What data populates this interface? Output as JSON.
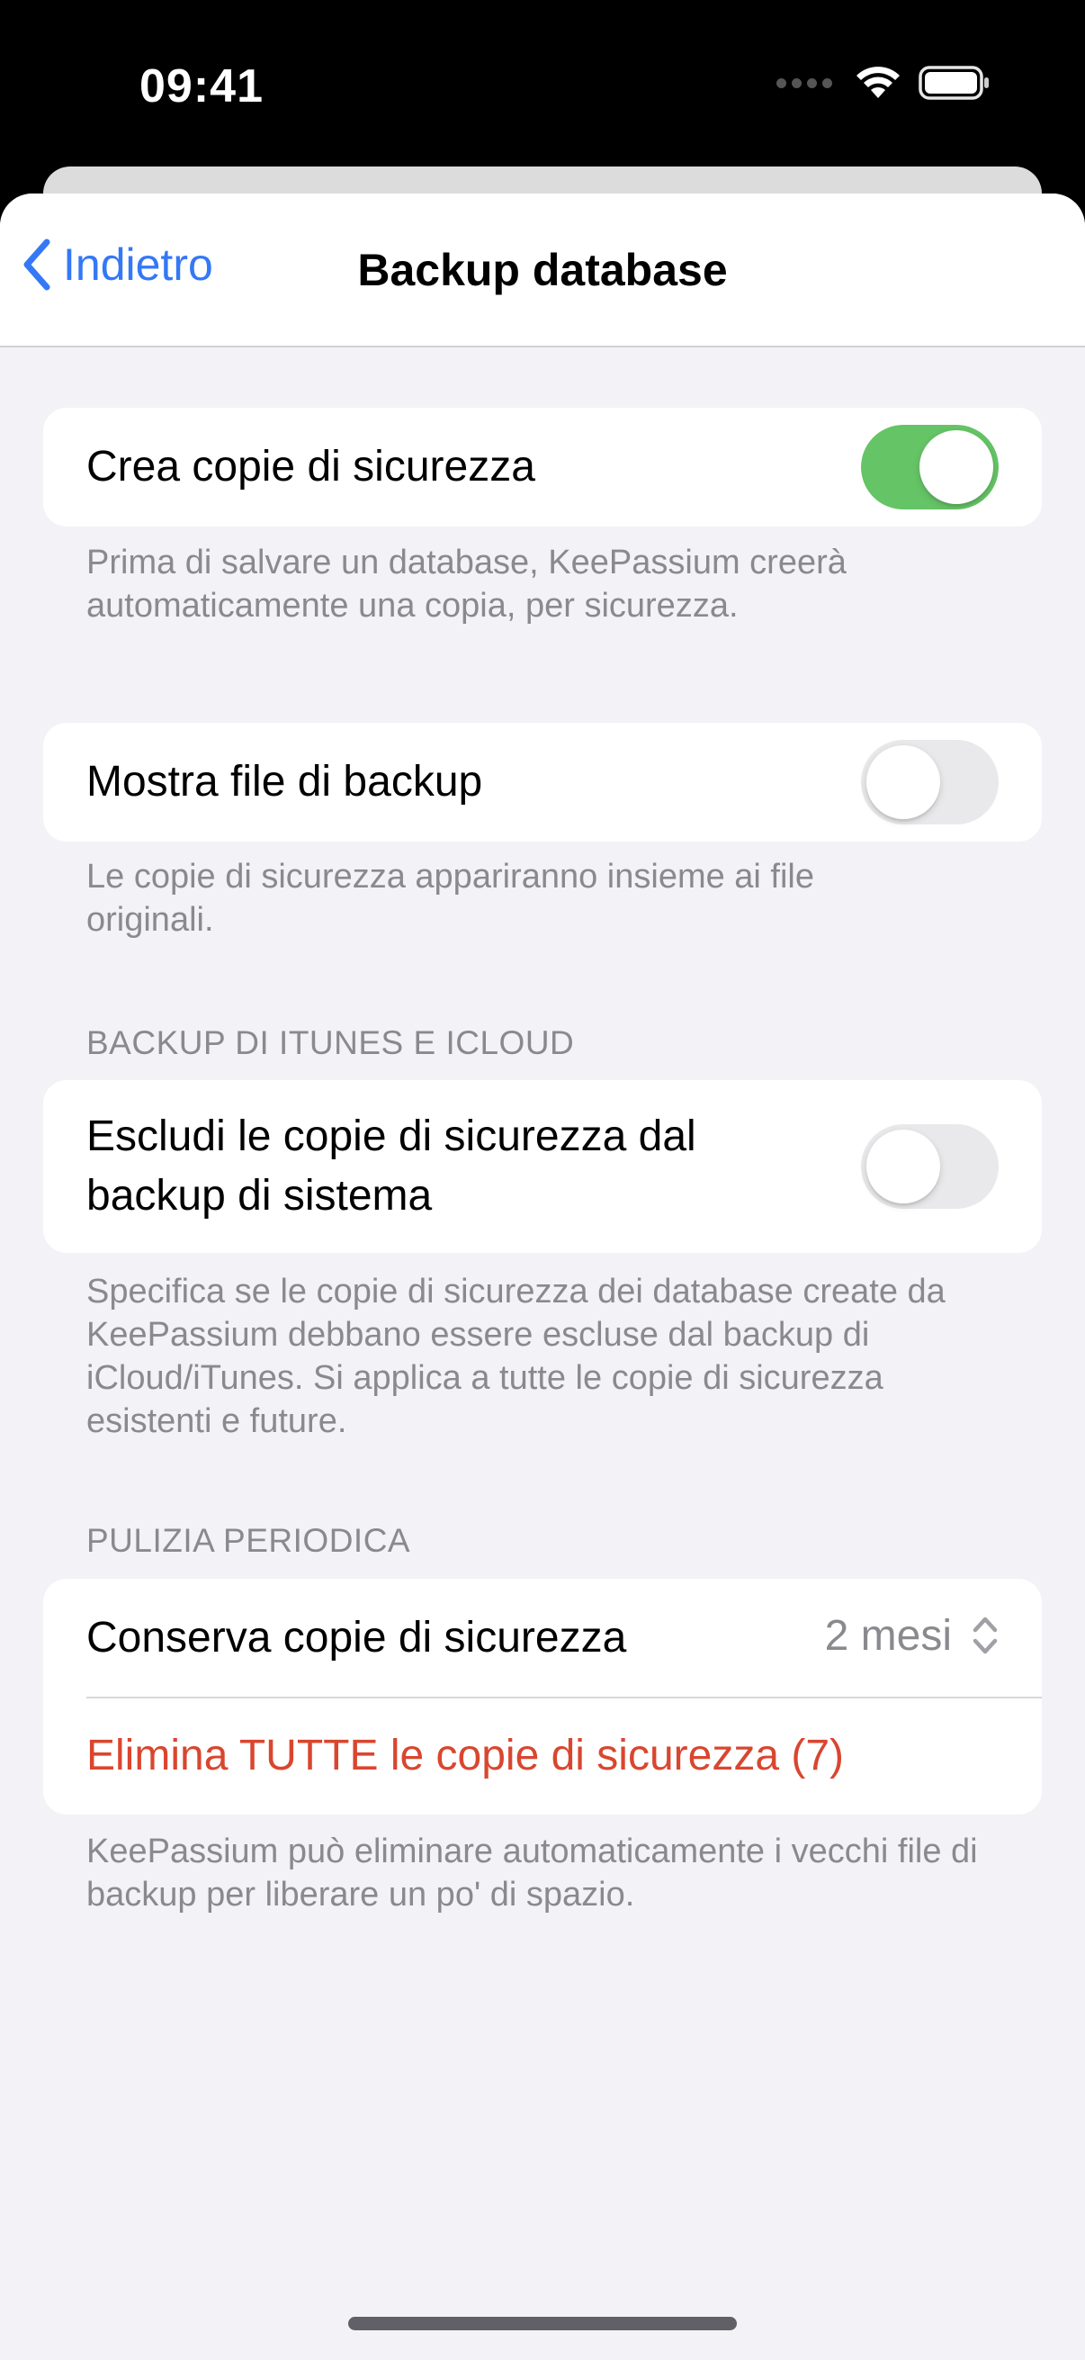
{
  "status_bar": {
    "time": "09:41"
  },
  "nav": {
    "back_label": "Indietro",
    "title": "Backup database"
  },
  "create_backups": {
    "label": "Crea copie di sicurezza",
    "enabled": true,
    "footer": "Prima di salvare un database, KeePassium creerà automaticamente una copia, per sicurezza."
  },
  "show_backup_files": {
    "label": "Mostra file di backup",
    "enabled": false,
    "footer": "Le copie di sicurezza appariranno insieme ai file originali."
  },
  "itunes_icloud": {
    "header": "BACKUP DI ITUNES E ICLOUD",
    "exclude_label": "Escludi le copie di sicurezza dal backup di sistema",
    "enabled": false,
    "footer": "Specifica se le copie di sicurezza dei database create da KeePassium debbano essere escluse dal backup di iCloud/iTunes. Si applica a tutte le copie di sicurezza esistenti e future."
  },
  "cleanup": {
    "header": "PULIZIA PERIODICA",
    "keep_label": "Conserva copie di sicurezza",
    "keep_value": "2 mesi",
    "delete_all_label": "Elimina TUTTE le copie di sicurezza (7)",
    "footer": "KeePassium può eliminare automaticamente i vecchi file di backup per liberare un po' di spazio."
  },
  "colors": {
    "accent": "#3478f6",
    "toggle_on": "#65c466",
    "destructive": "#d9462f",
    "background": "#f2f2f7"
  }
}
